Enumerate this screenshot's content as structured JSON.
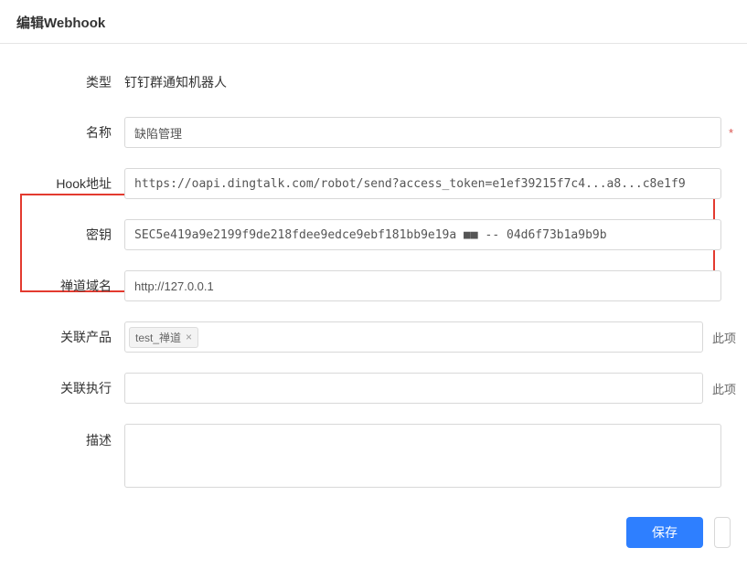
{
  "header": {
    "title": "编辑Webhook"
  },
  "form": {
    "type": {
      "label": "类型",
      "value": "钉钉群通知机器人"
    },
    "name": {
      "label": "名称",
      "value": "缺陷管理",
      "required_mark": "*"
    },
    "hook": {
      "label": "Hook地址",
      "value": "https://oapi.dingtalk.com/robot/send?access_token=e1ef39215f7c4...a8...c8e1f9"
    },
    "secret": {
      "label": "密钥",
      "value": "SEC5e419a9e2199f9de218fdee9edce9ebf181bb9e19a ■■ -- 04d6f73b1a9b9b"
    },
    "domain": {
      "label": "禅道域名",
      "value": "http://127.0.0.1"
    },
    "product": {
      "label": "关联产品",
      "tag": "test_禅道",
      "tag_remove": "×",
      "hint": "此项"
    },
    "exec": {
      "label": "关联执行",
      "value": "",
      "hint": "此项"
    },
    "desc": {
      "label": "描述",
      "value": ""
    }
  },
  "footer": {
    "save": "保存"
  }
}
